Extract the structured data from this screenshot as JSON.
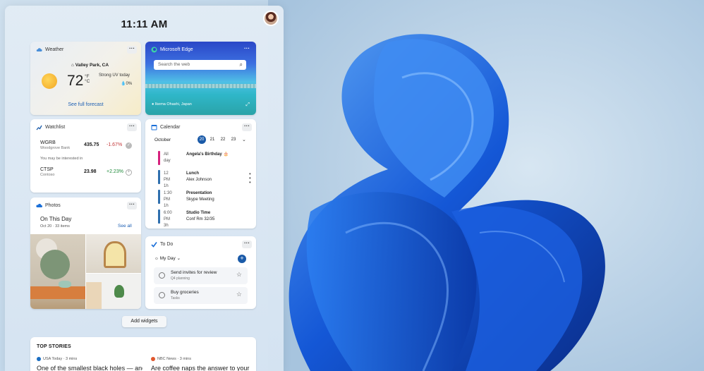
{
  "clock": "11:11 AM",
  "weather": {
    "title": "Weather",
    "location": "Valley Park, CA",
    "temp": "72",
    "unit_f": "°F",
    "unit_c": "°C",
    "uv": "Strong UV today",
    "rain": "0%",
    "link": "See full forecast"
  },
  "edge": {
    "title": "Microsoft Edge",
    "search_placeholder": "Search the web",
    "location": "Ikema Ohashi, Japan"
  },
  "watchlist": {
    "title": "Watchlist",
    "items": [
      {
        "symbol": "WGRB",
        "name": "Woodgrove Bank",
        "price": "435.75",
        "change": "-1.67%"
      },
      {
        "symbol": "CTSP",
        "name": "Contoso",
        "price": "23.98",
        "change": "+2.23%"
      }
    ],
    "note": "You may be interested in"
  },
  "photos": {
    "title": "Photos",
    "heading": "On This Day",
    "sub": "Oct 20 · 33 items",
    "link": "See all"
  },
  "calendar": {
    "title": "Calendar",
    "month": "October",
    "days": [
      "20",
      "21",
      "22",
      "23"
    ],
    "events": [
      {
        "time": "All day",
        "duration": "",
        "name": "Angela's Birthday 🎂",
        "detail": "",
        "color": "#d6217d"
      },
      {
        "time": "12 PM",
        "duration": "1h",
        "name": "Lunch",
        "detail": "Alex Johnson",
        "color": "#2f6fae"
      },
      {
        "time": "1:30 PM",
        "duration": "1h",
        "name": "Presentation",
        "detail": "Skype Meeting",
        "color": "#2f6fae"
      },
      {
        "time": "6:00 PM",
        "duration": "3h",
        "name": "Studio Time",
        "detail": "Conf Rm 32/35",
        "color": "#2f6fae"
      }
    ]
  },
  "todo": {
    "title": "To Do",
    "list": "My Day",
    "tasks": [
      {
        "title": "Send invites for review",
        "sub": "Q4 planning"
      },
      {
        "title": "Buy groceries",
        "sub": "Tasks"
      }
    ]
  },
  "add_widgets": "Add widgets",
  "stories": {
    "title": "TOP STORIES",
    "items": [
      {
        "source": "USA Today · 3 mins",
        "headline": "One of the smallest black holes — and",
        "color": "#1b6ec2"
      },
      {
        "source": "NBC News · 3 mins",
        "headline": "Are coffee naps the answer to your",
        "color": "#e0572d"
      }
    ]
  }
}
